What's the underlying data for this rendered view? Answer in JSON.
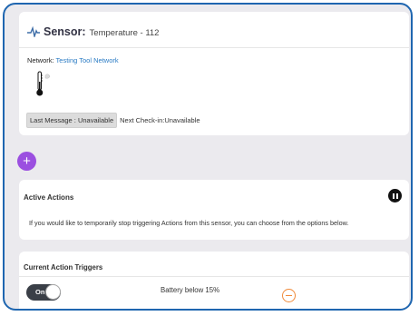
{
  "sensor": {
    "label": "Sensor:",
    "name": "Temperature - 112",
    "network_label": "Network:",
    "network_name": "Testing Tool Network",
    "last_message": "Last Message : Unavailable",
    "next_checkin": "Next Check-in:Unavailable"
  },
  "add_button": {
    "label": "+"
  },
  "active_actions": {
    "title": "Active Actions",
    "description": "If you would like to temporarily stop triggering Actions from this sensor, you can choose from the options below."
  },
  "triggers": {
    "title": "Current Action Triggers",
    "items": [
      {
        "toggle_label": "On",
        "description": "Battery below 15%"
      }
    ]
  },
  "colors": {
    "frame_border": "#1f66b0",
    "accent_purple": "#9b4fe0",
    "link_blue": "#2a7bc4",
    "remove_orange": "#f08a3a",
    "toggle_dark": "#3a3f47"
  },
  "icons": [
    "pulse-icon",
    "thermometer-icon",
    "plus-icon",
    "pause-icon",
    "minus-circle-icon"
  ]
}
